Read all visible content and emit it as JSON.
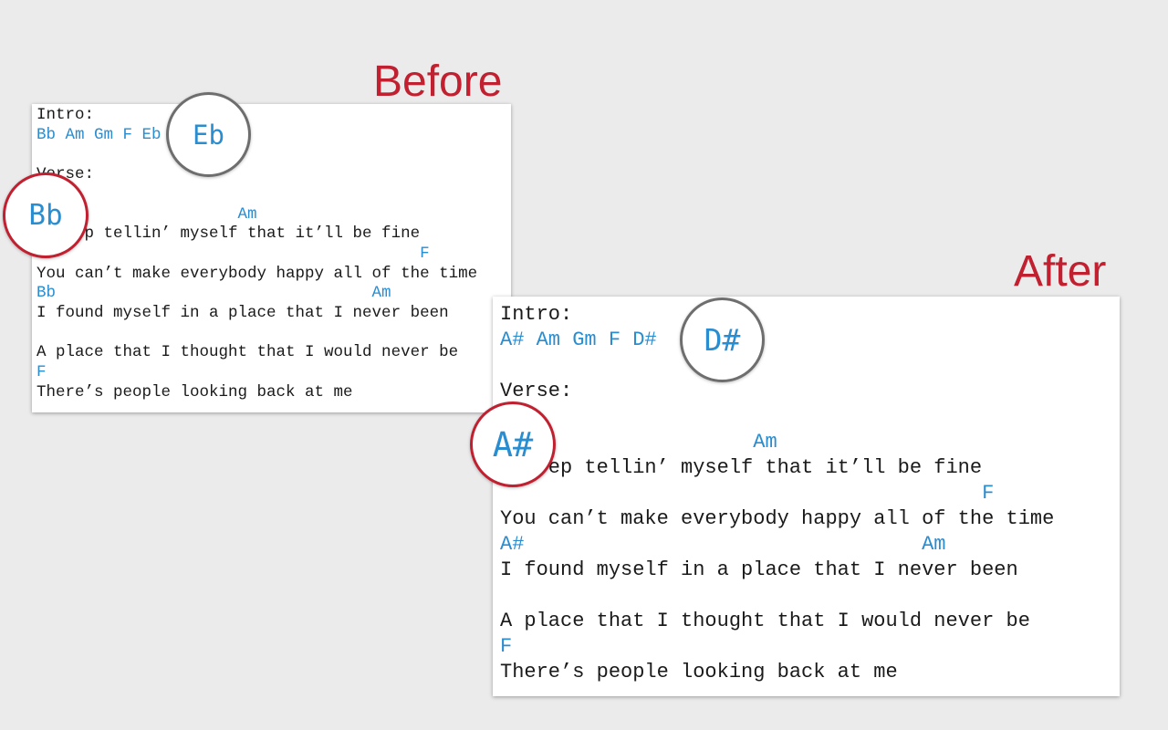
{
  "colors": {
    "background": "#ebebeb",
    "heading": "#c0202f",
    "chord": "#2a8dd0",
    "lyric": "#1a1a1a",
    "original_key_ring": "#6e6e6e",
    "transposed_ring": "#c0202f"
  },
  "before": {
    "heading": "Before",
    "lines": [
      {
        "kind": "lyric",
        "text": "Intro:"
      },
      {
        "kind": "chord",
        "text": "Bb Am Gm F Eb"
      },
      {
        "kind": "lyric",
        "text": ""
      },
      {
        "kind": "lyric",
        "text": "Verse:"
      },
      {
        "kind": "lyric",
        "text": ""
      },
      {
        "kind": "chord",
        "text": "                     Am"
      },
      {
        "kind": "lyric",
        "text": "I keep tellin’ myself that it’ll be fine"
      },
      {
        "kind": "chord",
        "text": "                                        F"
      },
      {
        "kind": "lyric",
        "text": "You can’t make everybody happy all of the time"
      },
      {
        "kind": "chord",
        "text": "Bb                                 Am"
      },
      {
        "kind": "lyric",
        "text": "I found myself in a place that I never been"
      },
      {
        "kind": "lyric",
        "text": ""
      },
      {
        "kind": "lyric",
        "text": "A place that I thought that I would never be"
      },
      {
        "kind": "chord",
        "text": "F"
      },
      {
        "kind": "lyric",
        "text": "There’s people looking back at me"
      }
    ],
    "key_bubble": "Eb",
    "opening_chord_bubble": "Bb"
  },
  "after": {
    "heading": "After",
    "lines": [
      {
        "kind": "lyric",
        "text": "Intro:"
      },
      {
        "kind": "chord",
        "text": "A# Am Gm F D#"
      },
      {
        "kind": "lyric",
        "text": ""
      },
      {
        "kind": "lyric",
        "text": "Verse:"
      },
      {
        "kind": "lyric",
        "text": ""
      },
      {
        "kind": "chord",
        "text": "                     Am"
      },
      {
        "kind": "lyric",
        "text": "I keep tellin’ myself that it’ll be fine"
      },
      {
        "kind": "chord",
        "text": "                                        F"
      },
      {
        "kind": "lyric",
        "text": "You can’t make everybody happy all of the time"
      },
      {
        "kind": "chord",
        "text": "A#                                 Am"
      },
      {
        "kind": "lyric",
        "text": "I found myself in a place that I never been"
      },
      {
        "kind": "lyric",
        "text": ""
      },
      {
        "kind": "lyric",
        "text": "A place that I thought that I would never be"
      },
      {
        "kind": "chord",
        "text": "F"
      },
      {
        "kind": "lyric",
        "text": "There’s people looking back at me"
      }
    ],
    "key_bubble": "D#",
    "opening_chord_bubble": "A#"
  }
}
